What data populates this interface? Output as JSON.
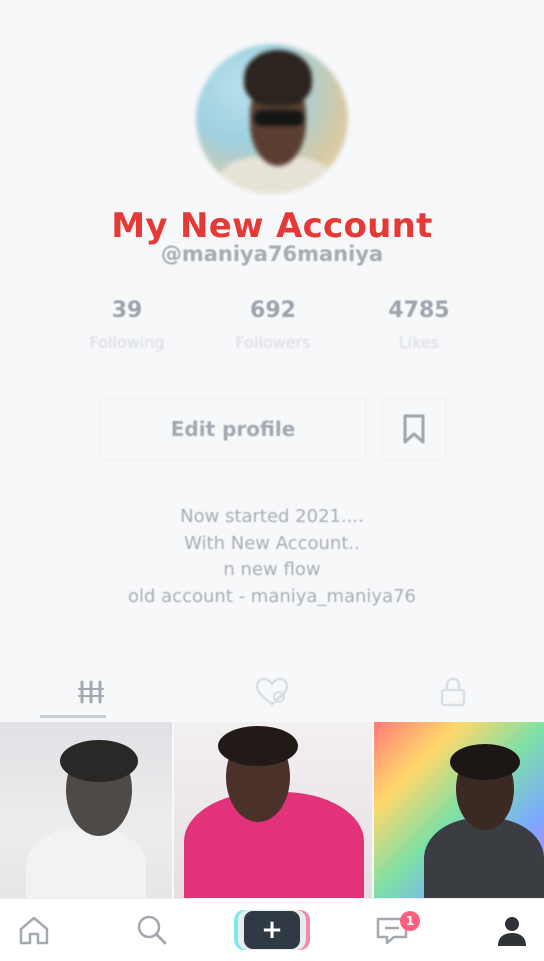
{
  "overlay": {
    "title": "My New Account"
  },
  "profile": {
    "username": "@maniya76maniya",
    "avatar_icon": "profile-photo"
  },
  "stats": [
    {
      "value": "39",
      "label": "Following"
    },
    {
      "value": "692",
      "label": "Followers"
    },
    {
      "value": "4785",
      "label": "Likes"
    }
  ],
  "actions": {
    "edit_profile_label": "Edit profile",
    "bookmark_icon": "bookmark-icon"
  },
  "bio": {
    "lines": [
      "Now started 2021....",
      "With New Account..",
      "n new flow",
      "old account - maniya_maniya76"
    ]
  },
  "tabs": [
    {
      "icon": "grid-icon",
      "active": true
    },
    {
      "icon": "liked-heart-icon",
      "active": false
    },
    {
      "icon": "lock-icon",
      "active": false
    }
  ],
  "nav": {
    "items": [
      {
        "icon": "home-icon"
      },
      {
        "icon": "search-icon"
      },
      {
        "icon": "plus-icon",
        "label": "+"
      },
      {
        "icon": "inbox-icon",
        "badge": "1"
      },
      {
        "icon": "profile-icon"
      }
    ]
  },
  "colors": {
    "accent_red": "#e53935",
    "badge": "#ff5e7e"
  }
}
